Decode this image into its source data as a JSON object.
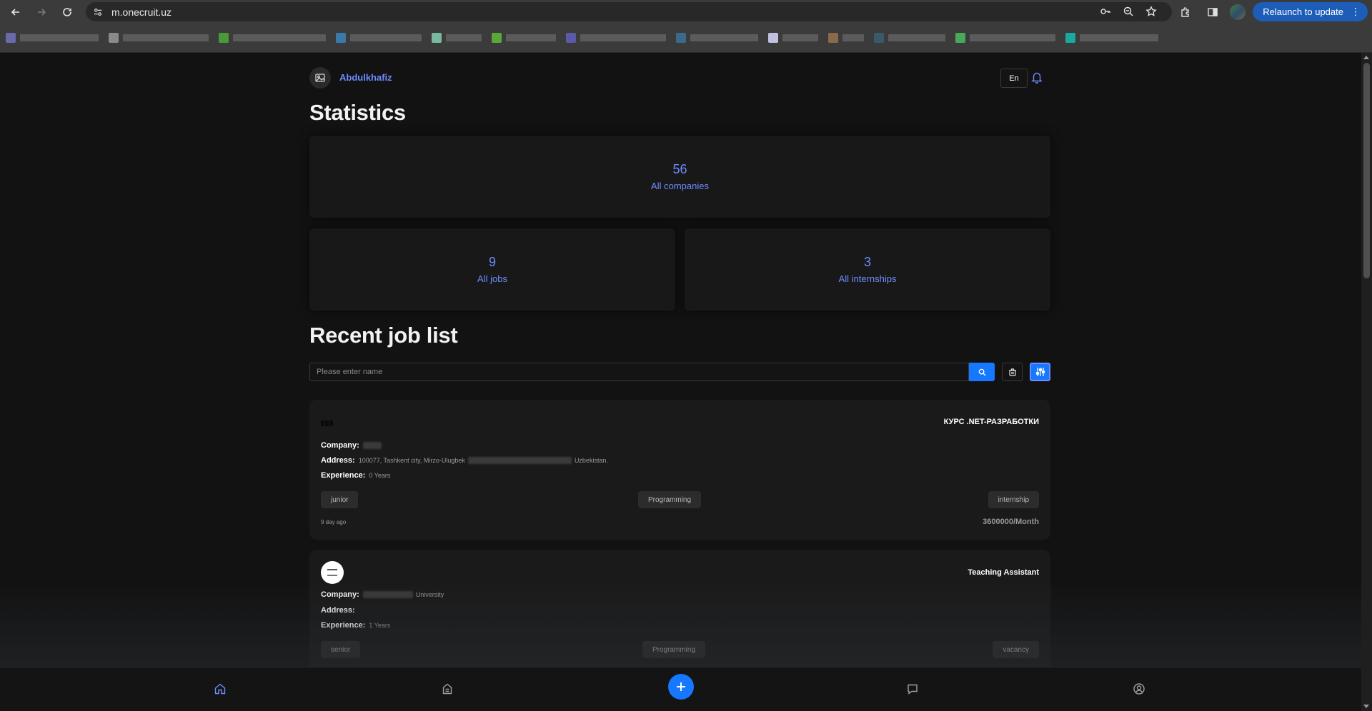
{
  "browser": {
    "url": "m.onecruit.uz",
    "relaunch_label": "Relaunch to update"
  },
  "header": {
    "username": "Abdulkhafiz",
    "language": "En"
  },
  "statistics": {
    "title": "Statistics",
    "companies": {
      "value": "56",
      "label": "All companies"
    },
    "jobs": {
      "value": "9",
      "label": "All jobs"
    },
    "internships": {
      "value": "3",
      "label": "All internships"
    }
  },
  "recent": {
    "title": "Recent job list",
    "search_placeholder": "Please enter name"
  },
  "jobs": [
    {
      "title": "КУРС .NET-РАЗРАБОТКИ",
      "company_label": "Company:",
      "address_label": "Address:",
      "address_value": "100077, Tashkent city, Mirzo-Ulugbek",
      "address_tail": "Uzbekistan.",
      "experience_label": "Experience:",
      "experience_value": "0 Years",
      "tags": [
        "junior",
        "Programming",
        "internship"
      ],
      "posted": "9 day ago",
      "salary": "3600000/Month"
    },
    {
      "title": "Teaching Assistant",
      "company_label": "Company:",
      "company_tail": "University",
      "address_label": "Address:",
      "experience_label": "Experience:",
      "experience_value": "1 Years",
      "tags": [
        "senior",
        "Programming",
        "vacancy"
      ]
    }
  ],
  "icons": {
    "back": "arrow-left-icon",
    "forward": "arrow-right-icon",
    "reload": "reload-icon",
    "bell": "bell-icon",
    "search": "search-icon",
    "clear": "trash-icon",
    "filter": "sliders-icon",
    "home": "home-icon",
    "jobs": "briefcase-icon",
    "add": "plus-icon",
    "chat": "chat-icon",
    "profile": "user-circle-icon"
  },
  "colors": {
    "accent": "#6e8cff",
    "primary_button": "#1677ff",
    "background": "#121212",
    "card": "#1a1a1a",
    "relaunch": "#1d5db8"
  }
}
